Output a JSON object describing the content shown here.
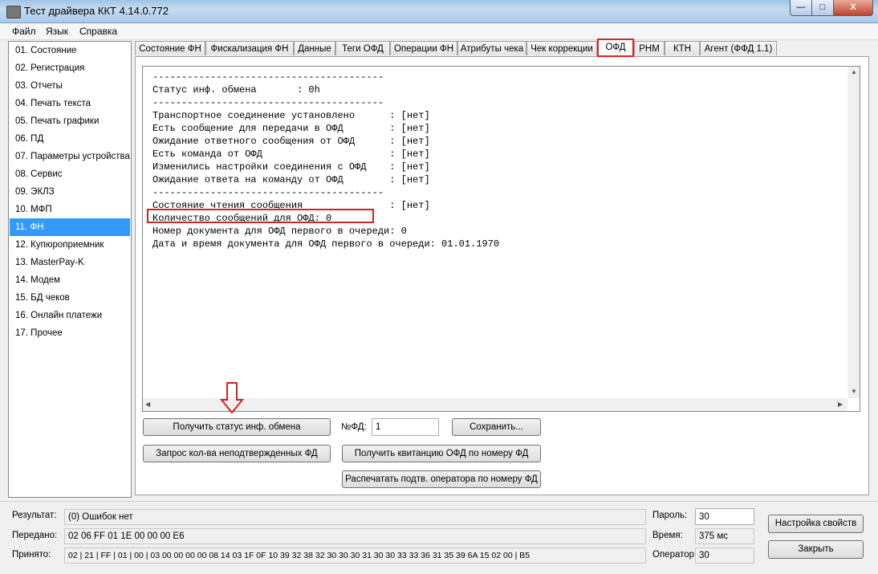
{
  "window": {
    "title": "Тест драйвера ККТ 4.14.0.772",
    "close_glyph": "X"
  },
  "menu": [
    "Файл",
    "Язык",
    "Справка"
  ],
  "sidebar": {
    "items": [
      "01. Состояние",
      "02. Регистрация",
      "03. Отчеты",
      "04. Печать текста",
      "05. Печать графики",
      "06. ПД",
      "07. Параметры устройства",
      "08. Сервис",
      "09. ЭКЛЗ",
      "10. МФП",
      "11. ФН",
      "12. Купюроприемник",
      "13. MasterPay-K",
      "14. Модем",
      "15. БД чеков",
      "16. Онлайн платежи",
      "17. Прочее"
    ],
    "selected": "11. ФН"
  },
  "tabs": [
    "Состояние ФН",
    "Фискализация ФН",
    "Данные",
    "Теги ОФД",
    "Операции ФН",
    "Атрибуты чека",
    "Чек коррекции",
    "ОФД",
    "РНМ",
    "КТН",
    "Агент (ФФД 1.1)"
  ],
  "active_tab": "ОФД",
  "console_lines": [
    "----------------------------------------",
    "Статус инф. обмена       : 0h",
    "----------------------------------------",
    "Транспортное соединение установлено      : [нет]",
    "Есть сообщение для передачи в ОФД        : [нет]",
    "Ожидание ответного сообщения от ОФД      : [нет]",
    "Есть команда от ОФД                      : [нет]",
    "Изменились настройки соединения с ОФД    : [нет]",
    "Ожидание ответа на команду от ОФД        : [нет]",
    "----------------------------------------",
    "Состояние чтения сообщения               : [нет]",
    "Количество сообщений для ОФД: 0",
    "Номер документа для ОФД первого в очереди: 0",
    "Дата и время документа для ОФД первого в очереди: 01.01.1970"
  ],
  "buttons": {
    "get_status": "Получить статус инф. обмена",
    "request_count": "Запрос кол-ва неподтвержденных ФД",
    "save": "Сохранить...",
    "get_receipt": "Получить квитанцию ОФД по номеру ФД",
    "print_confirm": "Распечатать подтв. оператора по номеру ФД",
    "settings": "Настройка свойств",
    "close": "Закрыть"
  },
  "fd_number": {
    "label": "№ФД:",
    "value": "1"
  },
  "status": {
    "result_label": "Результат:",
    "result": "(0) Ошибок нет",
    "sent_label": "Передано:",
    "sent": "02 06 FF 01 1E 00 00 00 E6",
    "received_label": "Принято:",
    "received": "02 | 21 | FF | 01 | 00 | 03 00 00 00 00 08 14 03 1F 0F 10 39 32 38 32 30 30 30 31 30 30 33 33 36 31 35 39 6A 15 02 00 | B5",
    "password_label": "Пароль:",
    "password": "30",
    "time_label": "Время:",
    "time": "375 мс",
    "operator_label": "Оператор:",
    "operator": "30"
  },
  "colors": {
    "selection": "#3399ff",
    "annotation": "#d22222"
  }
}
